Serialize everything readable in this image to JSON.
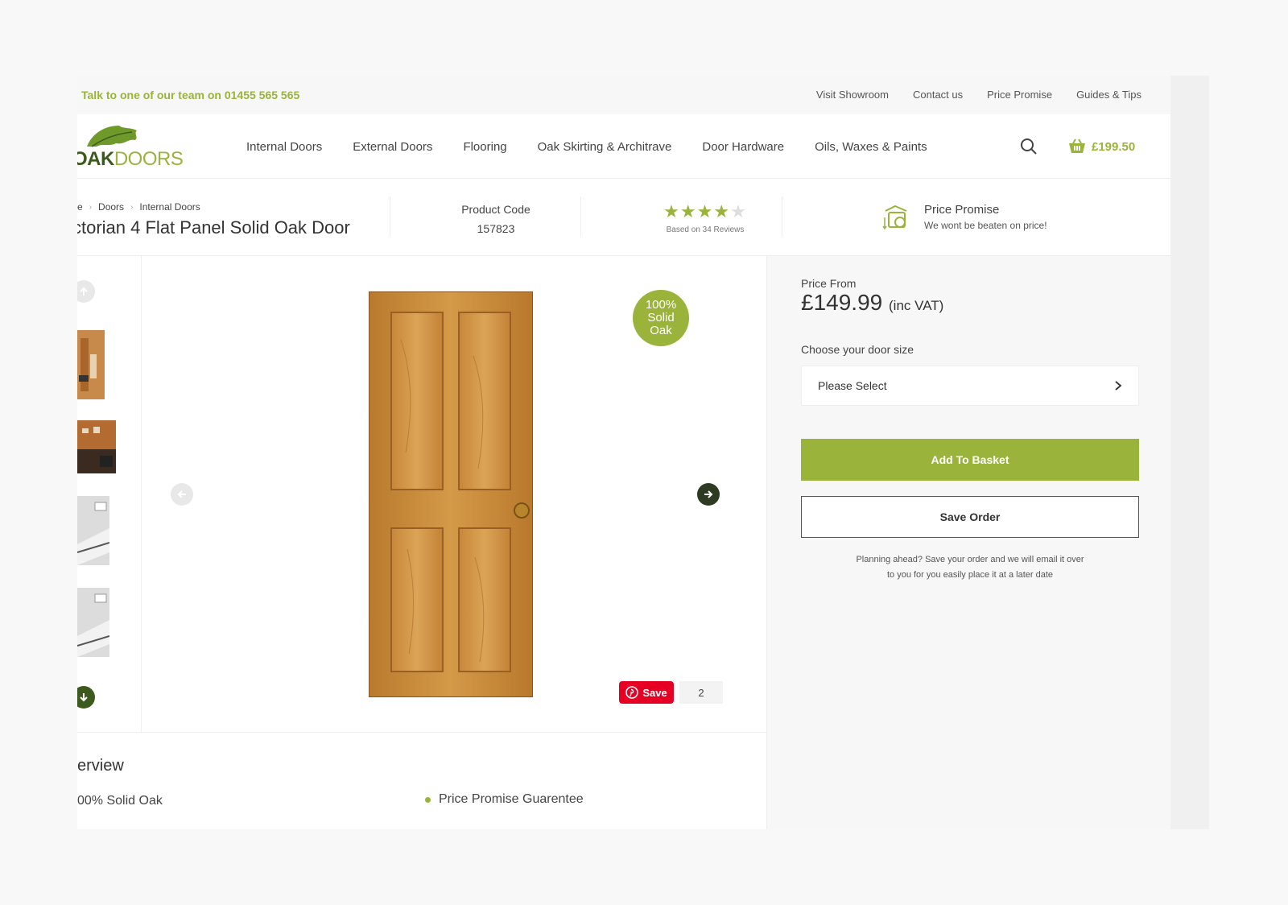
{
  "topbar": {
    "phone_text": "Talk to one of our team on 01455 565 565",
    "links": [
      "Visit Showroom",
      "Contact us",
      "Price Promise",
      "Guides & Tips"
    ]
  },
  "header": {
    "logo_oak": "OAK",
    "logo_doors": "DOORS",
    "nav": [
      "Internal Doors",
      "External Doors",
      "Flooring",
      "Oak Skirting & Architrave",
      "Door Hardware",
      "Oils, Waxes & Paints"
    ],
    "basket_total": "£199.50"
  },
  "product": {
    "breadcrumbs": [
      "e",
      "Doors",
      "Internal Doors"
    ],
    "title": "ctorian 4 Flat Panel Solid Oak Door",
    "code_label": "Product Code",
    "code_value": "157823",
    "rating_stars": 4,
    "rating_max": 5,
    "reviews_text": "Based on 34 Reviews",
    "promise_title": "Price Promise",
    "promise_sub": "We wont be beaten on price!"
  },
  "gallery": {
    "badge_lines": [
      "100%",
      "Solid",
      "Oak"
    ],
    "pin_label": "Save",
    "pin_count": "2"
  },
  "buybox": {
    "price_from_label": "Price From",
    "price": "£149.99",
    "price_vat": "(inc VAT)",
    "size_label": "Choose your door size",
    "size_placeholder": "Please Select",
    "add_to_basket": "Add To Basket",
    "save_order": "Save Order",
    "planning_text_1": "Planning ahead? Save your order and we will email it over",
    "planning_text_2": "to you for you easily place it at a later date"
  },
  "overview": {
    "title": "erview",
    "left_item": "00% Solid Oak",
    "right_item": "Price Promise Guarentee"
  },
  "colors": {
    "brand_green": "#9ab33b",
    "dark_green": "#3d5a1e",
    "pinterest_red": "#e60023"
  }
}
